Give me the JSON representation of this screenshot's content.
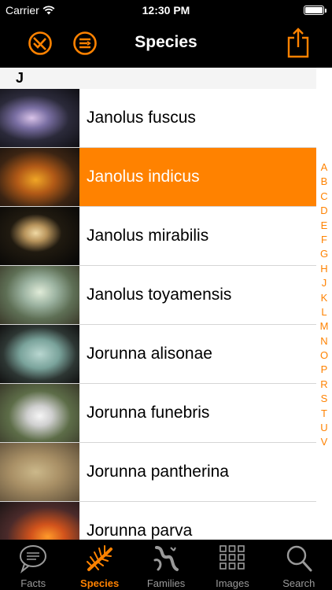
{
  "status_bar": {
    "carrier": "Carrier",
    "time": "12:30 PM"
  },
  "nav": {
    "title": "Species"
  },
  "section": {
    "letter": "J"
  },
  "species": [
    {
      "name": "Janolus fuscus",
      "selected": false
    },
    {
      "name": "Janolus indicus",
      "selected": true
    },
    {
      "name": "Janolus mirabilis",
      "selected": false
    },
    {
      "name": "Janolus toyamensis",
      "selected": false
    },
    {
      "name": "Jorunna alisonae",
      "selected": false
    },
    {
      "name": "Jorunna funebris",
      "selected": false
    },
    {
      "name": "Jorunna pantherina",
      "selected": false
    },
    {
      "name": "Jorunna parva",
      "selected": false
    }
  ],
  "index_letters": [
    "A",
    "B",
    "C",
    "D",
    "E",
    "F",
    "G",
    "H",
    "J",
    "K",
    "L",
    "M",
    "N",
    "O",
    "P",
    "R",
    "S",
    "T",
    "U",
    "V"
  ],
  "tabs": [
    {
      "label": "Facts",
      "icon": "speech-bubble-icon",
      "active": false
    },
    {
      "label": "Species",
      "icon": "nudibranch-icon",
      "active": true
    },
    {
      "label": "Families",
      "icon": "families-icon",
      "active": false
    },
    {
      "label": "Images",
      "icon": "grid-icon",
      "active": false
    },
    {
      "label": "Search",
      "icon": "search-icon",
      "active": false
    }
  ],
  "colors": {
    "accent": "#ff8200",
    "selected_row": "#ff8200",
    "tab_inactive": "#9a9a9a"
  }
}
